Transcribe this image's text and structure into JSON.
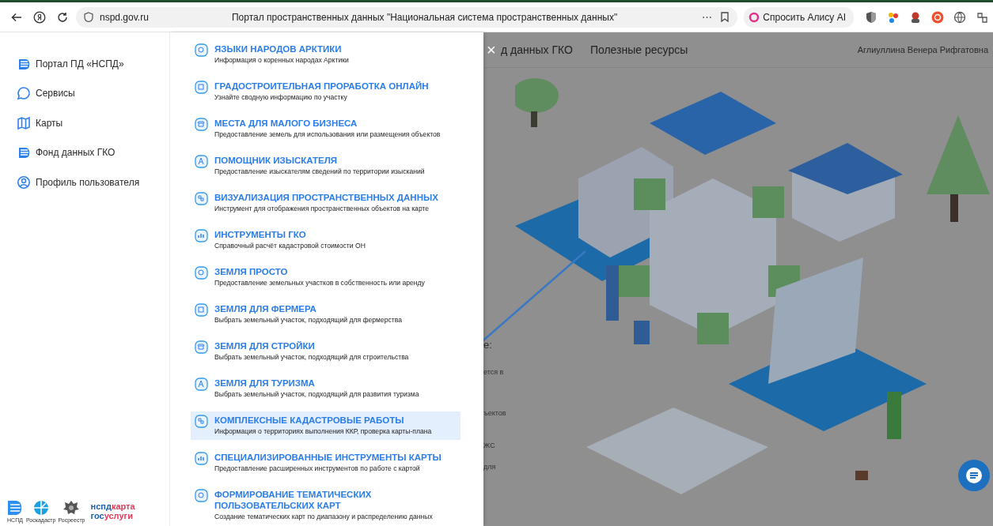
{
  "browser": {
    "url": "nspd.gov.ru",
    "page_title": "Портал пространственных данных \"Национальная система пространственных данных\"",
    "more": "⋯",
    "alice_button": "Спросить Алису AI"
  },
  "sidebar": {
    "items": [
      {
        "label": "Портал ПД «НСПД»",
        "kind": "layers"
      },
      {
        "label": "Сервисы",
        "kind": "bubble"
      },
      {
        "label": "Карты",
        "kind": "map"
      },
      {
        "label": "Фонд данных ГКО",
        "kind": "layers"
      },
      {
        "label": "Профиль пользователя",
        "kind": "user"
      }
    ],
    "logos": [
      {
        "caption": "НСПД",
        "kind": "nspd"
      },
      {
        "caption": "Роскадастр",
        "kind": "roskadastr"
      },
      {
        "caption": "Росреестр",
        "kind": "emblem"
      }
    ],
    "brand_lines": [
      [
        "нспд",
        "карта"
      ],
      [
        "гос",
        "услуги"
      ]
    ]
  },
  "services_menu": {
    "items": [
      {
        "title": "ЯЗЫКИ НАРОДОВ АРКТИКИ",
        "description": "Информация о коренных народах Арктики",
        "selected": false
      },
      {
        "title": "ГРАДОСТРОИТЕЛЬНАЯ ПРОРАБОТКА ОНЛАЙН",
        "description": "Узнайте сводную информацию по участку",
        "selected": false
      },
      {
        "title": "МЕСТА ДЛЯ МАЛОГО БИЗНЕСА",
        "description": "Предоставление земель для использования или размещения объектов",
        "selected": false
      },
      {
        "title": "ПОМОЩНИК ИЗЫСКАТЕЛЯ",
        "description": "Предоставление изыскателям сведений по территории изысканий",
        "selected": false
      },
      {
        "title": "ВИЗУАЛИЗАЦИЯ ПРОСТРАНСТВЕННЫХ ДАННЫХ",
        "description": "Инструмент для отображения пространственных объектов на карте",
        "selected": false
      },
      {
        "title": "ИНСТРУМЕНТЫ ГКО",
        "description": "Справочный расчёт кадастровой стоимости ОН",
        "selected": false
      },
      {
        "title": "ЗЕМЛЯ ПРОСТО",
        "description": "Предоставление земельных участков в собственность или аренду",
        "selected": false
      },
      {
        "title": "ЗЕМЛЯ ДЛЯ ФЕРМЕРА",
        "description": "Выбрать земельный участок, подходящий для фермерства",
        "selected": false
      },
      {
        "title": "ЗЕМЛЯ ДЛЯ СТРОЙКИ",
        "description": "Выбрать земельный участок, подходящий для строительства",
        "selected": false
      },
      {
        "title": "ЗЕМЛЯ ДЛЯ ТУРИЗМА",
        "description": "Выбрать земельный участок, подходящий для развития туризма",
        "selected": false
      },
      {
        "title": "КОМПЛЕКСНЫЕ КАДАСТРОВЫЕ РАБОТЫ",
        "description": "Информация о территориях выполнения ККР, проверка карты-плана",
        "selected": true
      },
      {
        "title": "СПЕЦИАЛИЗИРОВАННЫЕ ИНСТРУМЕНТЫ КАРТЫ",
        "description": "Предоставление расширенных инструментов по работе с картой",
        "selected": false
      },
      {
        "title": "ФОРМИРОВАНИЕ ТЕМАТИЧЕСКИХ ПОЛЬЗОВАТЕЛЬСКИХ КАРТ",
        "description": "Создание тематических карт по диапазону и распределению данных",
        "selected": false
      }
    ],
    "close": "×"
  },
  "background_page": {
    "nav": [
      "д данных ГКО",
      "Полезные ресурсы"
    ],
    "user_name": "Аглиуллина Венера Рифгатовна",
    "cut_texts": [
      "е:",
      "ется в",
      "ъектов",
      "ЖС",
      "для"
    ]
  }
}
